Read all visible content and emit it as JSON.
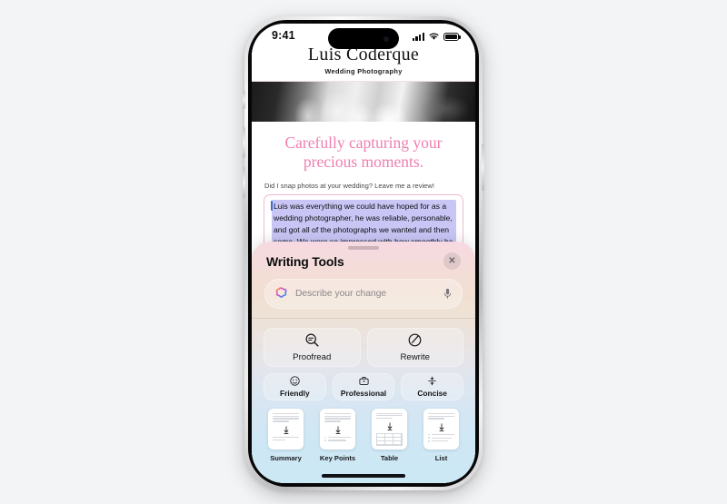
{
  "background_color": "#f3f4f6",
  "phone": {
    "status_bar": {
      "time": "9:41",
      "cellular_icon": "signal-bars-icon",
      "wifi_icon": "wifi-icon",
      "battery_icon": "battery-icon"
    },
    "home_indicator": "home-indicator"
  },
  "webpage": {
    "site_title": "Luis Coderque",
    "site_subtitle": "Wedding Photography",
    "hero_image_alt": "bride holding bouquet black and white photo",
    "headline_line1": "Carefully capturing your",
    "headline_line2": "precious moments.",
    "headline_color": "#ef7fb0",
    "review_prompt": "Did I snap photos at your wedding? Leave me a review!",
    "review_text": "Luis was everything we could have hoped for as a wedding photographer, he was reliable, personable, and got all of the photographs we wanted and then some. We were so impressed with how smoothly he circulated through our ceremony and reception. We barely realized he was there except when he was very",
    "selection_color": "#c9c6f5",
    "review_box_border_color": "#f0b9cf"
  },
  "writing_tools": {
    "title": "Writing Tools",
    "close_label": "✕",
    "input": {
      "placeholder": "Describe your change",
      "value": "",
      "leading_icon": "apple-intelligence-ring-icon",
      "trailing_icon": "microphone-icon"
    },
    "primary_actions": [
      {
        "label": "Proofread",
        "icon": "magnifier-text-icon"
      },
      {
        "label": "Rewrite",
        "icon": "pencil-circle-icon"
      }
    ],
    "tone_actions": [
      {
        "label": "Friendly",
        "icon": "smiley-face-icon"
      },
      {
        "label": "Professional",
        "icon": "briefcase-icon"
      },
      {
        "label": "Concise",
        "icon": "compress-arrows-icon"
      }
    ],
    "document_actions": [
      {
        "label": "Summary",
        "icon": "summary-document-icon"
      },
      {
        "label": "Key Points",
        "icon": "key-points-document-icon"
      },
      {
        "label": "Table",
        "icon": "table-document-icon"
      },
      {
        "label": "List",
        "icon": "list-document-icon"
      }
    ],
    "gradient_top": "#f6d9e2",
    "gradient_bottom": "#cbe8f5"
  }
}
